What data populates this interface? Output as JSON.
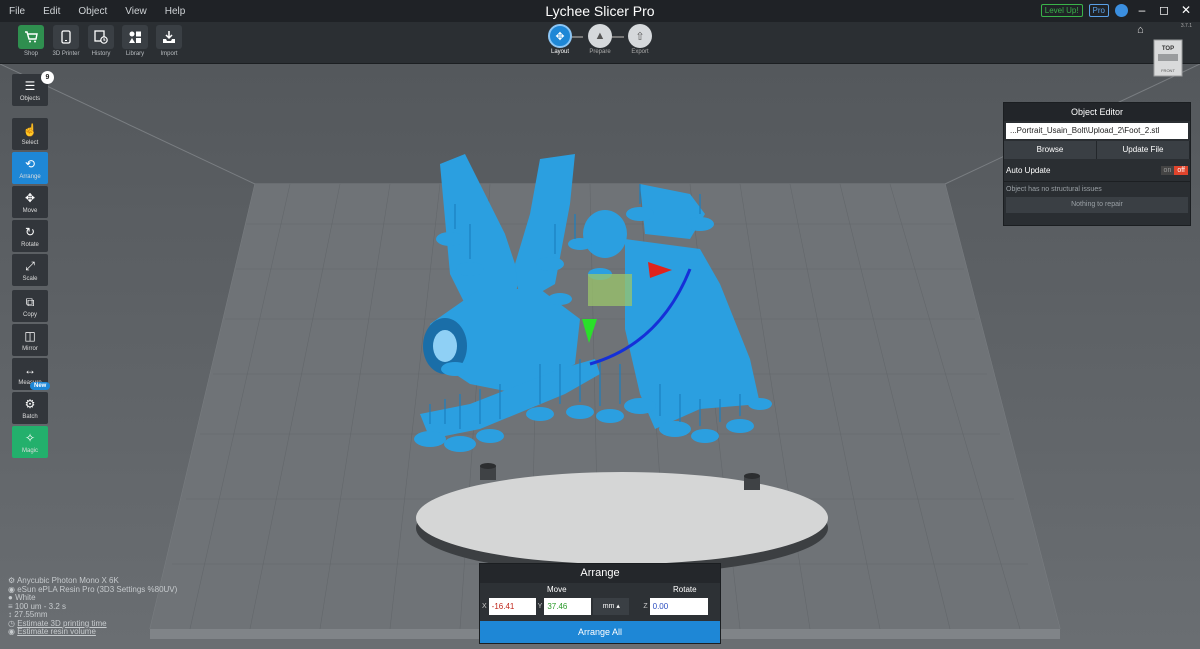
{
  "app": {
    "title": "Lychee Slicer Pro",
    "version": "3.7.1"
  },
  "menu": [
    "File",
    "Edit",
    "Object",
    "View",
    "Help"
  ],
  "window": {
    "level_up": "Level Up!",
    "pro": "Pro"
  },
  "toolbar": {
    "items": [
      {
        "label": "Shop",
        "icon": "cart-icon"
      },
      {
        "label": "3D Printer",
        "icon": "phone-printer-icon"
      },
      {
        "label": "History",
        "icon": "history-icon"
      },
      {
        "label": "Library",
        "icon": "library-icon"
      },
      {
        "label": "Import",
        "icon": "import-icon"
      }
    ]
  },
  "steps": [
    {
      "label": "Layout",
      "active": true
    },
    {
      "label": "Prepare",
      "active": false
    },
    {
      "label": "Export",
      "active": false
    }
  ],
  "sidebar": {
    "objects": {
      "label": "Objects",
      "count": "9"
    },
    "tools": [
      {
        "label": "Select"
      },
      {
        "label": "Arrange",
        "active": true
      },
      {
        "label": "Move"
      },
      {
        "label": "Rotate"
      },
      {
        "label": "Scale"
      },
      {
        "label": "Copy"
      },
      {
        "label": "Mirror"
      },
      {
        "label": "Measure"
      },
      {
        "label": "Batch",
        "badge": "New"
      },
      {
        "label": "Magic"
      }
    ]
  },
  "viewcube": {
    "top": "TOP",
    "front": "FRONT"
  },
  "object_editor": {
    "title": "Object Editor",
    "file": "...Portrait_Usain_Bolt\\Upload_2\\Foot_2.stl",
    "browse": "Browse",
    "update_file": "Update File",
    "auto_update": "Auto Update",
    "toggle_on": "on",
    "toggle_off": "off",
    "status": "Object has no structural issues",
    "repair": "Nothing to repair"
  },
  "arrange": {
    "title": "Arrange",
    "move_label": "Move",
    "rotate_label": "Rotate",
    "x_label": "X",
    "y_label": "Y",
    "z_label": "Z",
    "x_value": "-16.41",
    "y_value": "37.46",
    "unit": "mm",
    "z_value": "0.00",
    "button": "Arrange All"
  },
  "info": {
    "printer": "Anycubic Photon Mono X 6K",
    "resin": "eSun ePLA Resin Pro (3D3 Settings %80UV)",
    "color": "White",
    "layer": "100 um - 3.2 s",
    "height": "27.55mm",
    "estimate_time": "Estimate 3D printing time",
    "estimate_resin": "Estimate resin volume"
  }
}
